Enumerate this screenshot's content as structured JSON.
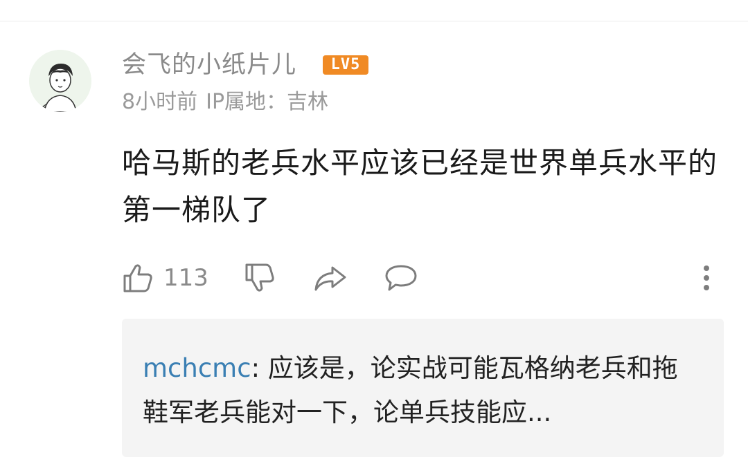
{
  "comment": {
    "username": "会飞的小纸片儿",
    "level_badge": "LV5",
    "time": "8小时前",
    "ip_location": "IP属地：吉林",
    "text": "哈马斯的老兵水平应该已经是世界单兵水平的第一梯队了",
    "like_count": "113"
  },
  "actions": {
    "icons": [
      "thumbs-up-icon",
      "thumbs-down-icon",
      "share-icon",
      "comment-icon",
      "more-icon"
    ]
  },
  "reply": {
    "user": "mchcmc",
    "separator": ": ",
    "text": "应该是，论实战可能瓦格纳老兵和拖鞋军老兵能对一下，论单兵技能应..."
  },
  "colors": {
    "username": "#8a8a8a",
    "badge": "#f08a24",
    "reply_user": "#3a7fb3",
    "reply_bg": "#f4f4f4"
  }
}
